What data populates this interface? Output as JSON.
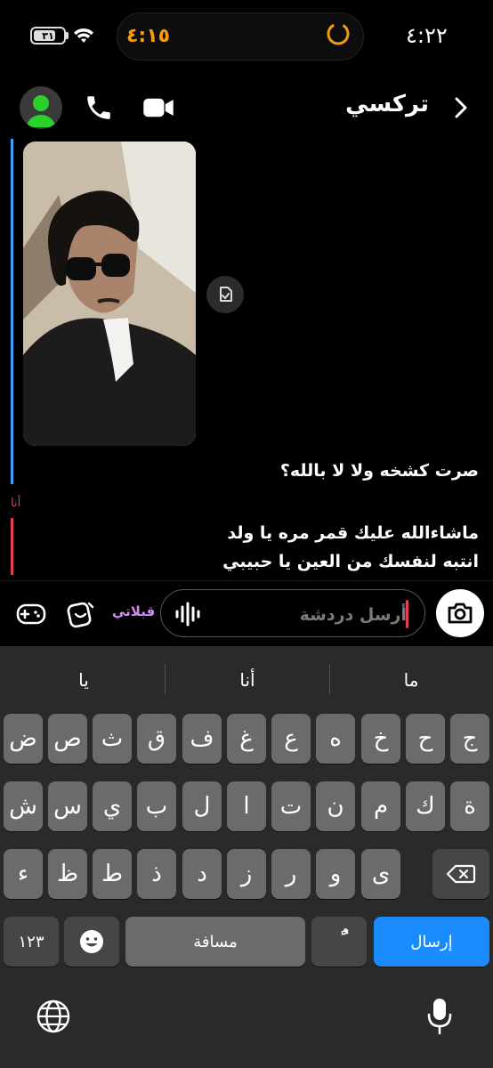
{
  "status_bar": {
    "clock": "٤:٢٢",
    "battery": "٣١",
    "island_timer": "٤:١٥"
  },
  "header": {
    "title": "تركسي"
  },
  "chat": {
    "incoming_messages": [
      "صرت كشخه ولا لا بالله؟"
    ],
    "me_label": "أنا",
    "outgoing_messages": [
      "ماشاءالله عليك قمر مره يا ولد",
      "انتبه لنفسك من العين يا حبيبي"
    ]
  },
  "composer": {
    "placeholder": "أرسل دردشة",
    "lens_label": "قبلاتي"
  },
  "keyboard": {
    "suggestions": [
      "ما",
      "أنا",
      "يا"
    ],
    "row1": [
      "ض",
      "ص",
      "ث",
      "ق",
      "ف",
      "غ",
      "ع",
      "ه",
      "خ",
      "ح",
      "ج"
    ],
    "row2": [
      "ش",
      "س",
      "ي",
      "ب",
      "ل",
      "ا",
      "ت",
      "ن",
      "م",
      "ك",
      "ة"
    ],
    "row3": [
      "ء",
      "ظ",
      "ط",
      "ذ",
      "د",
      "ز",
      "ر",
      "و",
      "ى"
    ],
    "numbers_key": "١٢٣",
    "space_key": "مسافة",
    "tanween_key": "ًٌ",
    "send_key": "إرسال"
  },
  "colors": {
    "accent_blue": "#1a8cff",
    "reply_red": "#e63c55",
    "reply_blue": "#3aa3ff",
    "island_orange": "#f39c12",
    "avatar_green": "#2bd12b"
  }
}
